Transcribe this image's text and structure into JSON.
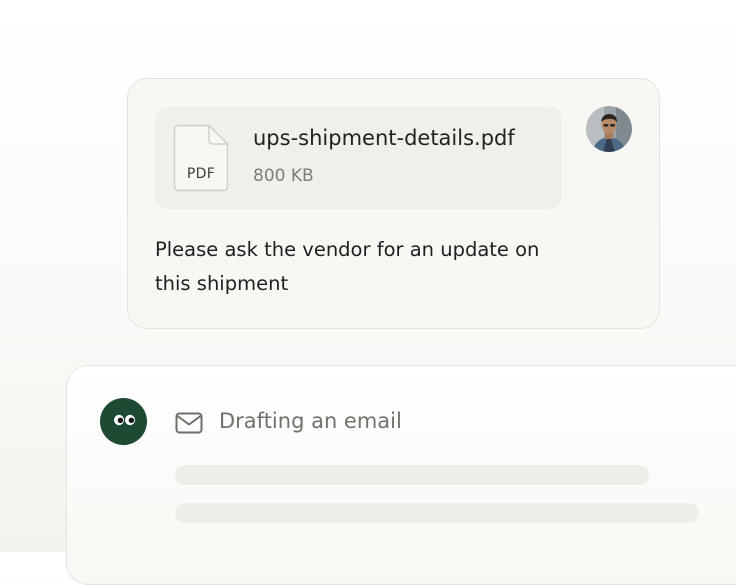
{
  "message": {
    "attachment": {
      "file_name": "ups-shipment-details.pdf",
      "file_size": "800 KB",
      "file_type": "PDF",
      "icon": "pdf-file-icon"
    },
    "user_avatar": "user-avatar",
    "text": "Please ask the vendor for an update on this shipment"
  },
  "email_draft": {
    "bot_avatar": "assistant-avatar",
    "icon": "mail-icon",
    "status_label": "Drafting an email"
  },
  "colors": {
    "card_background": "#f8f7f4",
    "attachment_background": "#eff0ea",
    "border": "#e6e4de",
    "bot_avatar": "#1e4a33",
    "skeleton": "#efede8"
  }
}
